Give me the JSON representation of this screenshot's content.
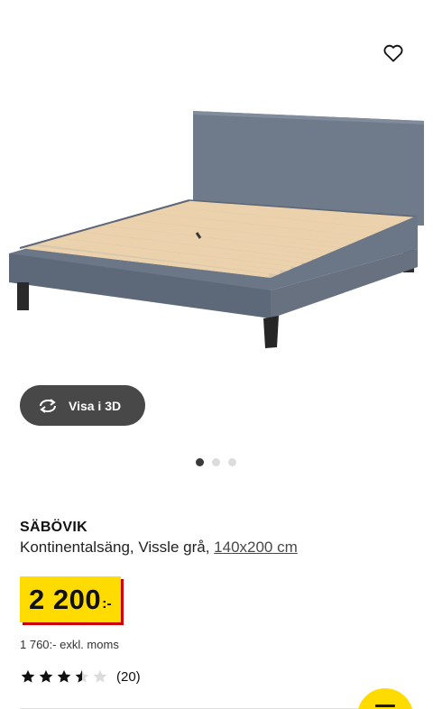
{
  "gallery": {
    "favorite_icon": "heart-outline-icon",
    "image_alt": "SÄBÖVIK bed frame",
    "view3d_label": "Visa i 3D",
    "view3d_icon": "rotate-arrows-icon",
    "dots": {
      "total": 3,
      "active": 1
    }
  },
  "product": {
    "name": "SÄBÖVIK",
    "description": "Kontinentalsäng, Vissle grå, ",
    "size": "140x200 cm",
    "price": "2 200",
    "price_suffix": ":-",
    "price_excl_vat": "1 760:- exkl. moms",
    "rating": 3.5,
    "rating_max": 5,
    "review_count": "(20)"
  },
  "colors": {
    "price_tag_bg": "#ffdb00",
    "price_tag_shadow": "#cc0008",
    "button_dark": "#484848",
    "bed_fabric": "#717c8c",
    "slats": "#e7c9a0"
  }
}
